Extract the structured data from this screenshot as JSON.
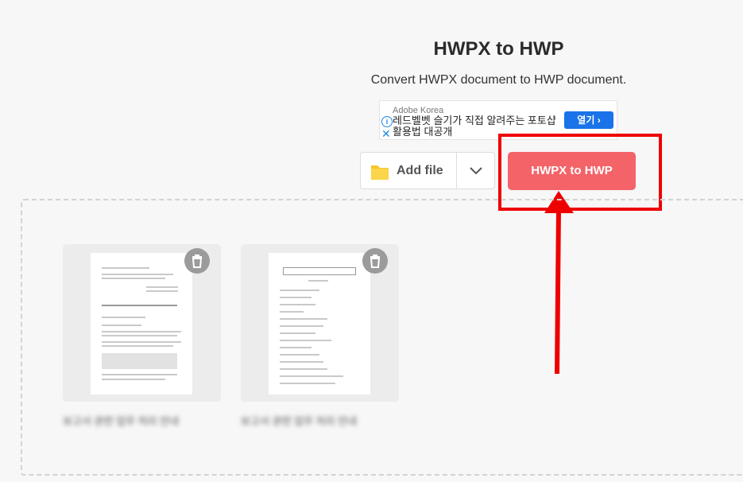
{
  "header": {
    "title": "HWPX to HWP",
    "subtitle": "Convert HWPX document to HWP document."
  },
  "ad": {
    "source": "Adobe Korea",
    "text": "레드벨벳 슬기가 직접 알려주는 포토샵 활용법 대공개",
    "open_label": "열기",
    "info_icon": "info-icon",
    "close_icon": "close-icon"
  },
  "toolbar": {
    "add_file_label": "Add file",
    "convert_label": "HWPX to HWP"
  },
  "files": [
    {
      "name": "보고서 관련 업무 처리 안내"
    },
    {
      "name": "보고서 관련 업무 처리 안내"
    }
  ],
  "colors": {
    "convert_button": "#f36368",
    "highlight": "#ee0000",
    "folder": "#f7c52c"
  }
}
